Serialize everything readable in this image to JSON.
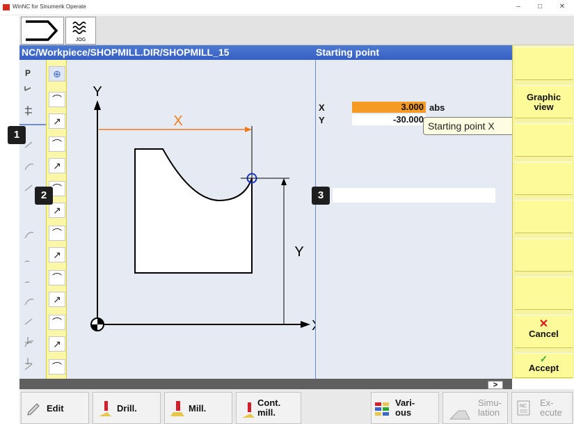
{
  "window": {
    "title": "WinNC for Sinumerik Operate",
    "min": "–",
    "max": "□",
    "close": "✕"
  },
  "toolbar": {
    "mode_label": "JOG"
  },
  "header": {
    "path": "NC/Workpiece/SHOPMILL.DIR/SHOPMILL_15",
    "right_title": "Starting point"
  },
  "leftcol": {
    "p_label": "P"
  },
  "params": [
    {
      "label": "X",
      "value": "3.000",
      "unit": "abs"
    },
    {
      "label": "Y",
      "value": "-30.000",
      "unit": ""
    }
  ],
  "tooltip": "Starting point X",
  "graphic": {
    "axis_y": "Y",
    "axis_x": "X",
    "dim_x": "X",
    "dim_y": "Y"
  },
  "softkeys": {
    "graphic_view_1": "Graphic",
    "graphic_view_2": "view",
    "cancel": "Cancel",
    "accept": "Accept"
  },
  "statusbar": {
    "arrow": ">"
  },
  "bottom": {
    "edit": "Edit",
    "drill": "Drill.",
    "mill": "Mill.",
    "cont_1": "Cont.",
    "cont_2": "mill.",
    "various_1": "Vari-",
    "various_2": "ous",
    "simulation_1": "Simu-",
    "simulation_2": "lation",
    "execute_1": "Ex-",
    "execute_2": "ecute"
  },
  "callouts": [
    "1",
    "2",
    "3"
  ],
  "colors": {
    "header": "#3a66c8",
    "softkey": "#fdfa9a",
    "input_active": "#f59a23",
    "panel": "#e6ebf3"
  }
}
